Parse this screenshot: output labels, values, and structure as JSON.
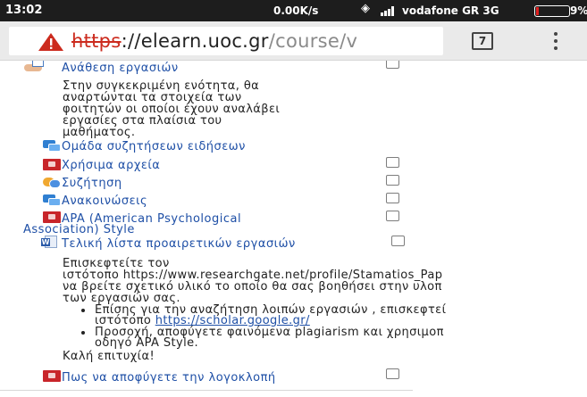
{
  "status_bar": {
    "time": "13:02",
    "network_speed": "0.00K/s",
    "carrier": "vodafone GR 3G",
    "battery": "9%"
  },
  "browser": {
    "url_scheme": "https",
    "url_host": "://elearn.uoc.gr",
    "url_path": "/course/v",
    "tab_count": "7",
    "warning_color": "#cc2b1e"
  },
  "course": {
    "assignment": {
      "title": "Ανάθεση εργασιών",
      "description": [
        "Στην συγκεκριμένη ενότητα, θα",
        "αναρτώνται τα στοιχεία των",
        "φοιτητών οι οποίοι έχουν αναλάβει",
        "εργασίες στα πλαίσια του",
        "μαθήματος."
      ]
    },
    "items": [
      {
        "label": "Ομάδα συζητήσεων ειδήσεων",
        "icon": "forum-icon",
        "checkbox": false
      },
      {
        "label": "Χρήσιμα αρχεία",
        "icon": "pdf-icon",
        "checkbox": true
      },
      {
        "label": "Συζήτηση",
        "icon": "chat-icon",
        "checkbox": true
      },
      {
        "label": "Ανακοινώσεις",
        "icon": "forum-icon",
        "checkbox": true
      }
    ],
    "apa": {
      "line1": "APA (American Psychological",
      "line2": "Association) Style"
    },
    "final_list": {
      "title": "Τελική λίστα προαιρετικών εργασιών",
      "text_lines": [
        "Επισκεφτείτε τον",
        "ιστότοπο https://www.researchgate.net/profile/Stamatios_Pap",
        "να βρείτε σχετικό υλικό το οποίο θα σας βοηθήσει στην υλοπ",
        "των εργασιών σας."
      ],
      "bullets": [
        {
          "line1": "Επίσης για την αναζήτηση λοιπών εργασιών , επισκεφτεί",
          "line2_prefix": "ιστότοπο ",
          "line2_link": "https://scholar.google.gr/"
        },
        {
          "line1": "Προσοχή, αποφύγετε φαινόμενα plagiarism και χρησιμοπ",
          "line2_prefix": "οδηγό APA Style.",
          "line2_link": ""
        }
      ],
      "closing": "Καλή επιτυχία!"
    },
    "plagiarism": {
      "label": "Πως να αποφύγετε την λογοκλοπή"
    }
  }
}
